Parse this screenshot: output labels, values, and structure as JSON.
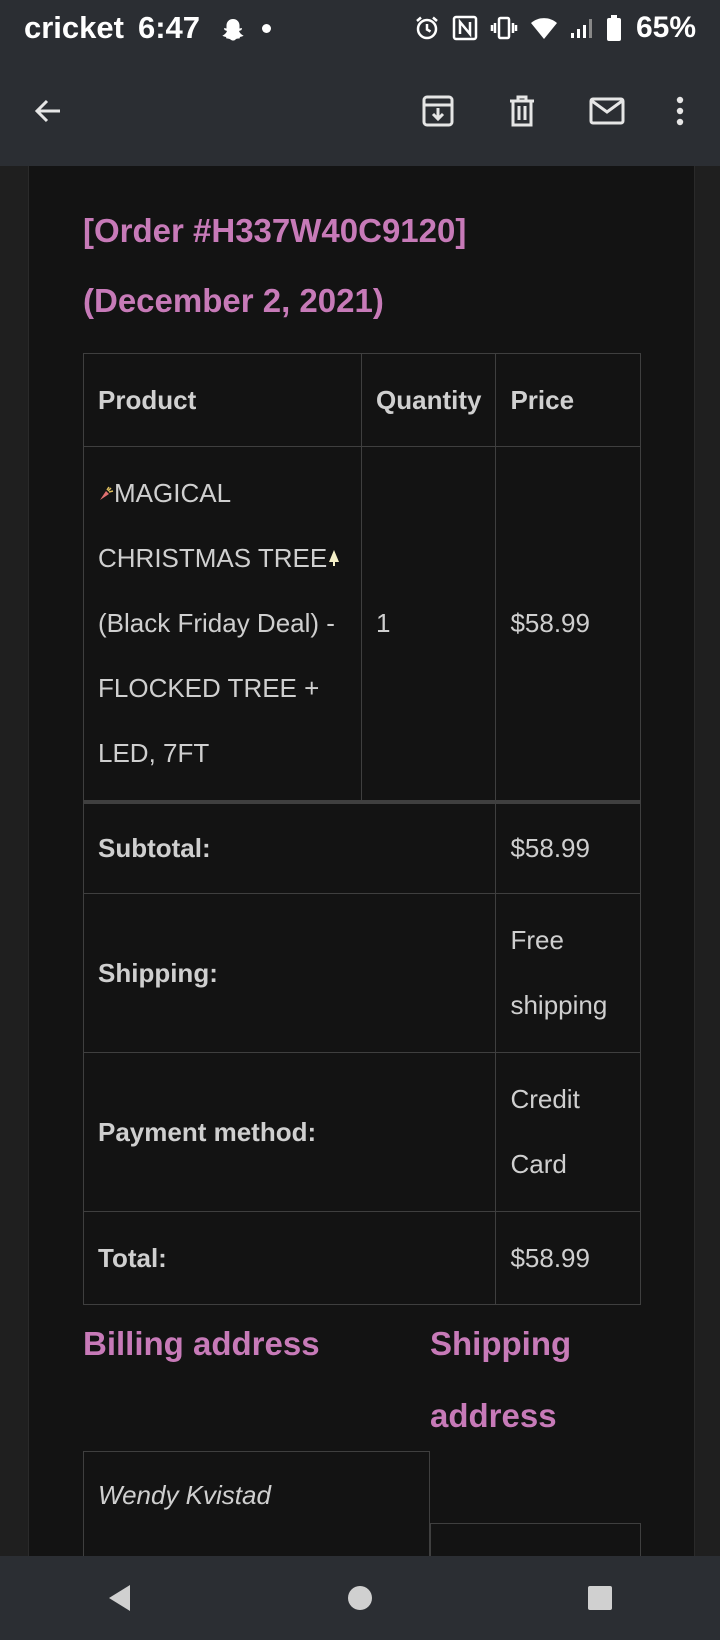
{
  "status_bar": {
    "carrier": "cricket",
    "time": "6:47",
    "battery": "65%",
    "icons": [
      "snapchat-icon",
      "alarm-icon",
      "nfc-icon",
      "vibrate-icon",
      "wifi-icon",
      "signal-icon",
      "battery-icon"
    ]
  },
  "app_bar": {
    "icons": [
      "back-arrow-icon",
      "archive-icon",
      "delete-icon",
      "mark-unread-icon",
      "more-vert-icon"
    ]
  },
  "order": {
    "title_line1": "[Order #H337W40C9120]",
    "title_line2": "(December 2, 2021)",
    "headers": {
      "product": "Product",
      "quantity": "Quantity",
      "price": "Price"
    },
    "items": [
      {
        "product_line1": "MAGICAL",
        "product_line2": "CHRISTMAS TREE",
        "product_line3": "(Black Friday Deal) -",
        "product_line4": "FLOCKED TREE +",
        "product_line5": "LED, 7FT",
        "quantity": "1",
        "price": "$58.99"
      }
    ],
    "subtotal_label": "Subtotal:",
    "subtotal_value": "$58.99",
    "shipping_label": "Shipping:",
    "shipping_value_line1": "Free",
    "shipping_value_line2": "shipping",
    "payment_label": "Payment method:",
    "payment_value_line1": "Credit",
    "payment_value_line2": "Card",
    "total_label": "Total:",
    "total_value": "$58.99"
  },
  "addresses": {
    "billing_title": "Billing address",
    "shipping_title_line1": "Shipping",
    "shipping_title_line2": "address",
    "billing_name": "Wendy Kvistad"
  },
  "colors": {
    "accent_heading": "#c77ab8",
    "background": "#131313",
    "chrome": "#2b2e33"
  }
}
